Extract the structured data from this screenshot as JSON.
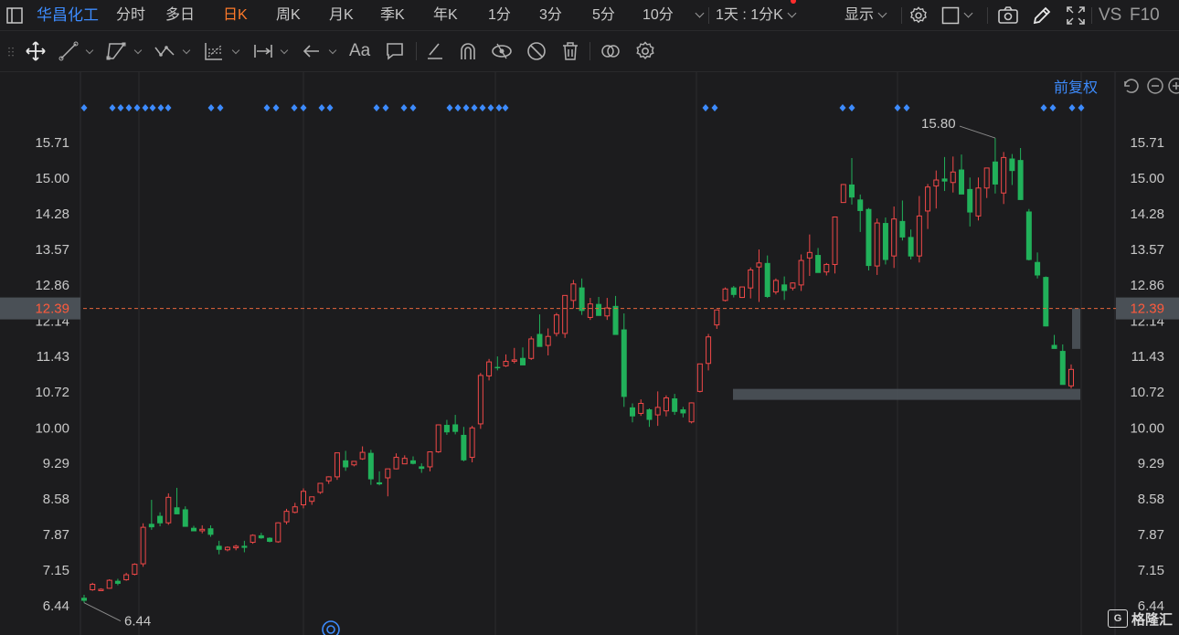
{
  "toolbar": {
    "stock_name": "华昌化工",
    "items": [
      "分时",
      "多日",
      "日K",
      "周K",
      "月K",
      "季K",
      "年K",
      "1分",
      "3分",
      "5分",
      "10分"
    ],
    "active_item": "日K",
    "period_select": "1天 : 1分K",
    "display_label": "显示",
    "vs_label": "VS",
    "f10_label": "F10"
  },
  "draw_tools": [
    "move-tool",
    "line-tool",
    "channel-tool",
    "wave-tool",
    "fib-tool",
    "measure-tool",
    "arrow-tool",
    "text-tool",
    "comment-tool",
    "eraser-tool",
    "magnet-tool",
    "show-drawings-tool",
    "hide-drawings-tool",
    "delete-tool",
    "compare-tool",
    "settings-tool"
  ],
  "draw_text_label": "Aa",
  "adjust_label": "前复权",
  "watermark": "格隆汇",
  "colors": {
    "up": "#f04848",
    "down": "#21b15a",
    "accent": "#3d8bfd",
    "active": "#ff7a2a",
    "current_price_line": "#e8663c"
  },
  "chart_data": {
    "type": "candlestick",
    "title": "",
    "xlabel": "",
    "ylabel": "",
    "y_ticks": [
      "15.71",
      "15.00",
      "14.28",
      "13.57",
      "12.86",
      "12.14",
      "11.43",
      "10.72",
      "10.00",
      "9.29",
      "8.58",
      "7.87",
      "7.15",
      "6.44"
    ],
    "ylim": [
      6.2,
      16.4
    ],
    "current_price": "12.39",
    "max_label": "15.80",
    "min_label": "6.44",
    "grid": true,
    "ohlc": [
      [
        6.6,
        6.66,
        6.5,
        6.54
      ],
      [
        6.76,
        6.9,
        6.74,
        6.87
      ],
      [
        6.76,
        6.79,
        6.74,
        6.77
      ],
      [
        6.79,
        6.97,
        6.78,
        6.95
      ],
      [
        6.94,
        6.98,
        6.85,
        6.88
      ],
      [
        6.96,
        7.1,
        6.94,
        7.06
      ],
      [
        7.07,
        7.29,
        7.05,
        7.27
      ],
      [
        7.28,
        8.09,
        7.22,
        8.01
      ],
      [
        8.08,
        8.56,
        7.96,
        8.01
      ],
      [
        8.24,
        8.31,
        8.03,
        8.09
      ],
      [
        8.1,
        8.69,
        8.06,
        8.61
      ],
      [
        8.41,
        8.8,
        8.27,
        8.27
      ],
      [
        8.37,
        8.43,
        8.05,
        8.02
      ],
      [
        8.0,
        8.04,
        7.93,
        7.93
      ],
      [
        7.94,
        8.05,
        7.89,
        7.97
      ],
      [
        7.99,
        8.05,
        7.82,
        7.86
      ],
      [
        7.64,
        7.74,
        7.47,
        7.56
      ],
      [
        7.56,
        7.63,
        7.53,
        7.61
      ],
      [
        7.6,
        7.66,
        7.55,
        7.63
      ],
      [
        7.64,
        7.74,
        7.51,
        7.6
      ],
      [
        7.71,
        7.87,
        7.68,
        7.85
      ],
      [
        7.85,
        7.9,
        7.78,
        7.79
      ],
      [
        7.8,
        7.81,
        7.71,
        7.72
      ],
      [
        7.72,
        8.11,
        7.7,
        8.1
      ],
      [
        8.12,
        8.38,
        8.07,
        8.33
      ],
      [
        8.31,
        8.5,
        8.29,
        8.42
      ],
      [
        8.46,
        8.79,
        8.39,
        8.73
      ],
      [
        8.53,
        8.62,
        8.46,
        8.62
      ],
      [
        8.71,
        8.89,
        8.68,
        8.89
      ],
      [
        8.94,
        9.03,
        8.88,
        9.02
      ],
      [
        9.02,
        9.5,
        8.96,
        9.5
      ],
      [
        9.35,
        9.54,
        9.14,
        9.21
      ],
      [
        9.26,
        9.33,
        9.23,
        9.33
      ],
      [
        9.38,
        9.63,
        9.36,
        9.51
      ],
      [
        9.5,
        9.56,
        8.86,
        8.97
      ],
      [
        8.91,
        9.13,
        8.85,
        8.87
      ],
      [
        9.0,
        9.13,
        8.63,
        9.18
      ],
      [
        9.18,
        9.49,
        9.17,
        9.41
      ],
      [
        9.28,
        9.45,
        9.28,
        9.39
      ],
      [
        9.35,
        9.43,
        9.27,
        9.28
      ],
      [
        9.23,
        9.29,
        9.1,
        9.18
      ],
      [
        9.22,
        9.53,
        9.13,
        9.52
      ],
      [
        9.52,
        10.07,
        9.5,
        10.06
      ],
      [
        10.06,
        10.16,
        9.86,
        9.91
      ],
      [
        10.07,
        10.26,
        9.87,
        9.92
      ],
      [
        9.86,
        10.02,
        9.33,
        9.35
      ],
      [
        9.41,
        10.04,
        9.31,
        10.0
      ],
      [
        10.08,
        11.1,
        9.98,
        11.05
      ],
      [
        11.04,
        11.38,
        10.95,
        11.32
      ],
      [
        11.22,
        11.43,
        11.15,
        11.2
      ],
      [
        11.24,
        11.47,
        11.22,
        11.33
      ],
      [
        11.36,
        11.6,
        11.29,
        11.36
      ],
      [
        11.4,
        11.61,
        11.36,
        11.25
      ],
      [
        11.39,
        11.83,
        11.36,
        11.78
      ],
      [
        11.88,
        12.27,
        11.64,
        11.62
      ],
      [
        11.65,
        11.99,
        11.45,
        11.83
      ],
      [
        11.89,
        12.3,
        11.83,
        12.26
      ],
      [
        11.89,
        12.49,
        11.8,
        12.65
      ],
      [
        12.55,
        12.96,
        12.39,
        12.88
      ],
      [
        12.81,
        12.99,
        12.26,
        12.34
      ],
      [
        12.21,
        12.6,
        12.16,
        12.48
      ],
      [
        12.48,
        12.62,
        12.26,
        12.24
      ],
      [
        12.24,
        12.6,
        12.16,
        12.4
      ],
      [
        12.44,
        12.64,
        11.91,
        11.86
      ],
      [
        11.97,
        12.29,
        10.42,
        10.62
      ],
      [
        10.41,
        10.49,
        10.11,
        10.23
      ],
      [
        10.29,
        10.57,
        10.24,
        10.49
      ],
      [
        10.37,
        10.39,
        10.02,
        10.16
      ],
      [
        10.26,
        10.73,
        10.04,
        10.41
      ],
      [
        10.34,
        10.65,
        10.23,
        10.6
      ],
      [
        10.59,
        10.68,
        10.26,
        10.32
      ],
      [
        10.37,
        10.42,
        10.21,
        10.29
      ],
      [
        10.12,
        10.51,
        10.09,
        10.5
      ],
      [
        10.73,
        11.24,
        10.71,
        11.28
      ],
      [
        11.29,
        11.88,
        11.15,
        11.82
      ],
      [
        12.06,
        12.36,
        11.98,
        12.36
      ],
      [
        12.55,
        12.81,
        12.53,
        12.78
      ],
      [
        12.81,
        12.84,
        12.61,
        12.66
      ],
      [
        12.61,
        12.81,
        12.6,
        12.82
      ],
      [
        12.8,
        13.21,
        12.59,
        13.16
      ],
      [
        13.22,
        13.57,
        12.52,
        13.3
      ],
      [
        13.3,
        13.45,
        12.6,
        12.62
      ],
      [
        12.72,
        12.99,
        12.67,
        12.95
      ],
      [
        12.87,
        13.03,
        12.56,
        12.74
      ],
      [
        12.8,
        12.91,
        12.75,
        12.9
      ],
      [
        12.86,
        13.47,
        12.74,
        13.35
      ],
      [
        13.4,
        13.87,
        13.04,
        13.51
      ],
      [
        13.46,
        13.6,
        13.12,
        13.1
      ],
      [
        13.12,
        13.3,
        13.05,
        13.27
      ],
      [
        13.27,
        14.22,
        13.09,
        14.22
      ],
      [
        14.51,
        14.88,
        14.55,
        14.87
      ],
      [
        14.87,
        15.4,
        14.47,
        14.61
      ],
      [
        14.57,
        14.67,
        13.92,
        14.34
      ],
      [
        14.38,
        14.4,
        13.15,
        13.24
      ],
      [
        13.24,
        14.19,
        13.06,
        14.1
      ],
      [
        14.1,
        14.21,
        13.27,
        13.36
      ],
      [
        13.44,
        14.43,
        13.2,
        14.18
      ],
      [
        14.14,
        14.55,
        13.75,
        13.81
      ],
      [
        13.82,
        13.97,
        13.37,
        13.43
      ],
      [
        13.44,
        14.64,
        13.31,
        14.24
      ],
      [
        14.34,
        14.88,
        13.98,
        14.82
      ],
      [
        14.84,
        15.15,
        14.39,
        14.96
      ],
      [
        14.99,
        15.42,
        14.74,
        14.93
      ],
      [
        14.91,
        15.43,
        14.71,
        15.12
      ],
      [
        15.17,
        15.47,
        14.69,
        14.67
      ],
      [
        14.78,
        15.01,
        14.03,
        14.31
      ],
      [
        14.24,
        15.01,
        14.15,
        14.8
      ],
      [
        14.8,
        15.18,
        14.6,
        15.2
      ],
      [
        15.33,
        15.8,
        14.69,
        14.87
      ],
      [
        14.7,
        15.52,
        14.48,
        15.41
      ],
      [
        15.39,
        15.48,
        14.86,
        15.14
      ],
      [
        15.36,
        15.6,
        14.56,
        14.56
      ],
      [
        14.33,
        14.38,
        13.35,
        13.36
      ],
      [
        13.32,
        13.51,
        12.99,
        13.05
      ],
      [
        13.02,
        13.03,
        12.03,
        12.03
      ],
      [
        11.66,
        11.86,
        11.59,
        11.58
      ],
      [
        11.54,
        11.67,
        10.9,
        10.86
      ],
      [
        10.84,
        11.27,
        10.79,
        11.17
      ]
    ]
  }
}
